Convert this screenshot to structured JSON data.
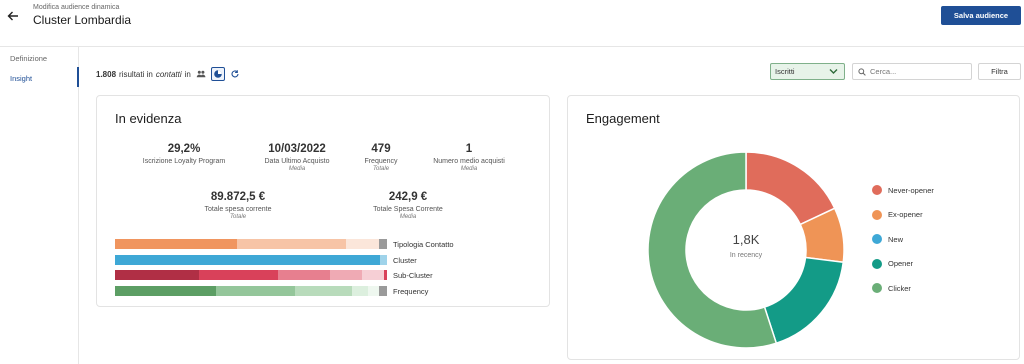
{
  "header": {
    "subtitle": "Modifica audience dinamica",
    "title": "Cluster Lombardia",
    "save_label": "Salva audience",
    "back_icon": "arrow-left-icon"
  },
  "sidebar": {
    "items": [
      {
        "label": "Definizione",
        "active": false
      },
      {
        "label": "Insight",
        "active": true
      }
    ]
  },
  "toolbar": {
    "count": "1.808",
    "results_text": "risultati in",
    "context": "contatti",
    "in_text": "in",
    "icons": [
      "people-icon",
      "pie-chart-icon",
      "refresh-icon"
    ],
    "select_value": "Iscritti",
    "search_placeholder": "Cerca...",
    "filter_label": "Filtra"
  },
  "evidenza": {
    "title": "In evidenza",
    "kpis": [
      {
        "value": "29,2%",
        "label": "Iscrizione Loyalty Program",
        "sub": ""
      },
      {
        "value": "10/03/2022",
        "label": "Data Ultimo Acquisto",
        "sub": "Media"
      },
      {
        "value": "479",
        "label": "Frequency",
        "sub": "Totale"
      },
      {
        "value": "1",
        "label": "Numero medio acquisti",
        "sub": "Media"
      },
      {
        "value": "89.872,5 €",
        "label": "Totale spesa corrente",
        "sub": "Totale"
      },
      {
        "value": "242,9 €",
        "label": "Totale Spesa Corrente",
        "sub": "Media"
      }
    ],
    "bars": [
      {
        "label": "Tipologia Contatto",
        "segments": [
          {
            "fraction": 0.45,
            "color": "#f0955f"
          },
          {
            "fraction": 0.4,
            "color": "#f7c4a6"
          },
          {
            "fraction": 0.12,
            "color": "#fbe6da"
          },
          {
            "fraction": 0.03,
            "color": "#9a9a9a"
          }
        ]
      },
      {
        "label": "Cluster",
        "segments": [
          {
            "fraction": 0.975,
            "color": "#3ea8d6"
          },
          {
            "fraction": 0.025,
            "color": "#9fd3ea"
          }
        ]
      },
      {
        "label": "Sub-Cluster",
        "segments": [
          {
            "fraction": 0.31,
            "color": "#b02f45"
          },
          {
            "fraction": 0.29,
            "color": "#d9415a"
          },
          {
            "fraction": 0.19,
            "color": "#e77f8f"
          },
          {
            "fraction": 0.12,
            "color": "#efaab4"
          },
          {
            "fraction": 0.08,
            "color": "#f6cfd5"
          },
          {
            "fraction": 0.01,
            "color": "#d9415a"
          }
        ]
      },
      {
        "label": "Frequency",
        "segments": [
          {
            "fraction": 0.37,
            "color": "#5c9e64"
          },
          {
            "fraction": 0.29,
            "color": "#94c69a"
          },
          {
            "fraction": 0.21,
            "color": "#b8dbbb"
          },
          {
            "fraction": 0.06,
            "color": "#dcefde"
          },
          {
            "fraction": 0.04,
            "color": "#eef7ef"
          },
          {
            "fraction": 0.03,
            "color": "#9a9a9a"
          }
        ]
      }
    ]
  },
  "engagement": {
    "title": "Engagement",
    "center_value": "1,8K",
    "center_label": "In recency"
  },
  "chart_data": {
    "type": "pie",
    "categories": [
      "Never-opener",
      "Ex-opener",
      "New",
      "Opener",
      "Clicker"
    ],
    "values": [
      18,
      9,
      0,
      18,
      55
    ],
    "colors": [
      "#e06c5b",
      "#ef9456",
      "#3ea8d6",
      "#139b87",
      "#6aae77"
    ],
    "title": "Engagement",
    "legend_position": "right"
  }
}
